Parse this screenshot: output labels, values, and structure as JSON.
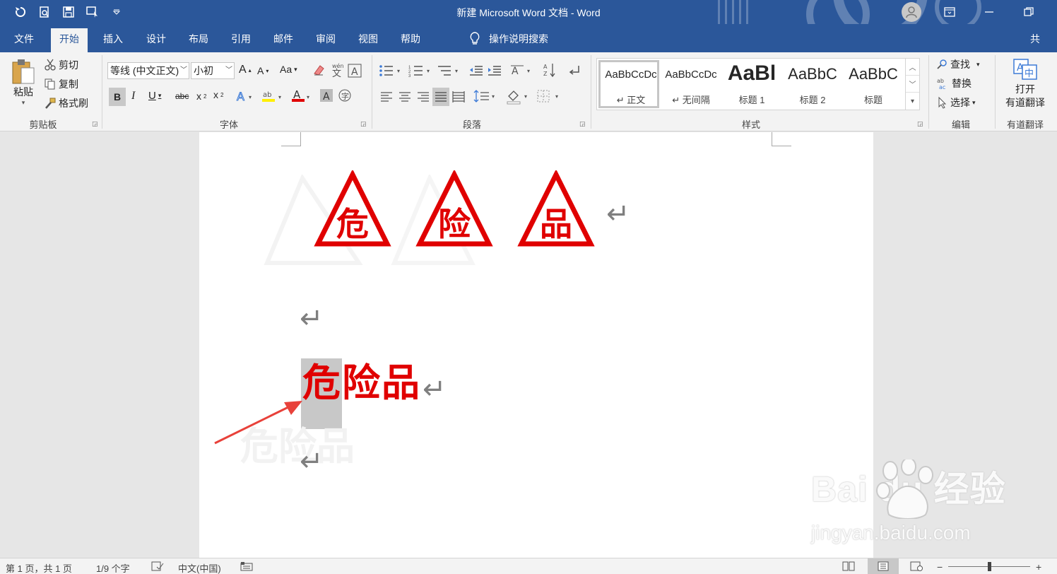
{
  "window": {
    "title": "新建 Microsoft Word 文档 - Word",
    "qat_icons": [
      "undo-icon",
      "print-preview-icon",
      "save-icon",
      "touch-mode-icon",
      "customize-qat-icon"
    ]
  },
  "tabs": {
    "items": [
      "文件",
      "开始",
      "插入",
      "设计",
      "布局",
      "引用",
      "邮件",
      "审阅",
      "视图",
      "帮助"
    ],
    "active": "开始",
    "tell_me": "操作说明搜索",
    "share": "共"
  },
  "clipboard": {
    "paste": "粘贴",
    "cut": "剪切",
    "copy": "复制",
    "format_painter": "格式刷",
    "label": "剪贴板"
  },
  "font": {
    "family": "等线 (中文正文)",
    "size": "小初",
    "change_case": "Aa",
    "label": "字体"
  },
  "paragraph": {
    "label": "段落"
  },
  "styles": {
    "items": [
      {
        "preview": "AaBbCcDc",
        "label": "↵ 正文"
      },
      {
        "preview": "AaBbCcDc",
        "label": "↵ 无间隔"
      },
      {
        "preview": "AaBl",
        "label": "标题 1"
      },
      {
        "preview": "AaBbC",
        "label": "标题 2"
      },
      {
        "preview": "AaBbC",
        "label": "标题"
      }
    ],
    "label": "样式"
  },
  "editing": {
    "find": "查找",
    "replace": "替换",
    "select": "选择",
    "label": "编辑"
  },
  "youdao": {
    "open_line1": "打开",
    "open_line2": "有道翻译",
    "label": "有道翻译"
  },
  "document": {
    "triangle_chars": [
      "危",
      "险",
      "品"
    ],
    "line_text_selected": "危",
    "line_text_rest": "险品",
    "paragraph_mark": "↵",
    "colors": {
      "red": "#e00000",
      "selection": "#c8c8c8"
    }
  },
  "watermark": {
    "brand": "Bai du 经验",
    "url": "jingyan.baidu.com"
  },
  "status": {
    "page": "第 1 页，共 1 页",
    "words": "1/9 个字",
    "language": "中文(中国)",
    "zoom_minus": "−",
    "zoom_plus": "+"
  },
  "colors": {
    "ribbon_blue": "#2b579a",
    "ribbon_bg": "#f3f3f3"
  }
}
